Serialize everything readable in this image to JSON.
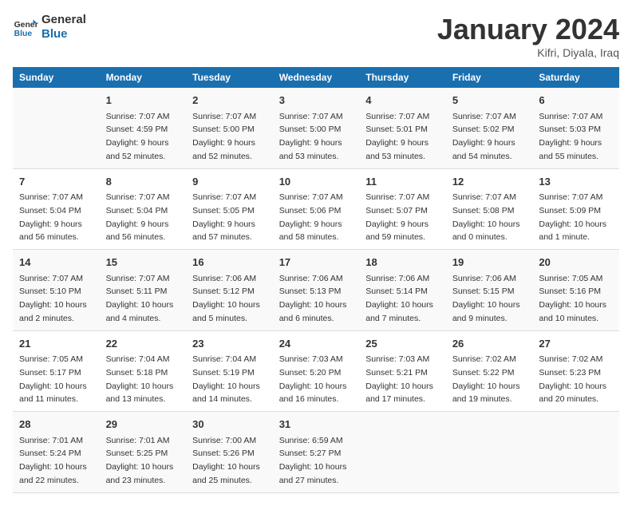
{
  "header": {
    "logo_line1": "General",
    "logo_line2": "Blue",
    "month_title": "January 2024",
    "location": "Kifri, Diyala, Iraq"
  },
  "weekdays": [
    "Sunday",
    "Monday",
    "Tuesday",
    "Wednesday",
    "Thursday",
    "Friday",
    "Saturday"
  ],
  "weeks": [
    [
      {
        "day": "",
        "sunrise": "",
        "sunset": "",
        "daylight": ""
      },
      {
        "day": "1",
        "sunrise": "Sunrise: 7:07 AM",
        "sunset": "Sunset: 4:59 PM",
        "daylight": "Daylight: 9 hours and 52 minutes."
      },
      {
        "day": "2",
        "sunrise": "Sunrise: 7:07 AM",
        "sunset": "Sunset: 5:00 PM",
        "daylight": "Daylight: 9 hours and 52 minutes."
      },
      {
        "day": "3",
        "sunrise": "Sunrise: 7:07 AM",
        "sunset": "Sunset: 5:00 PM",
        "daylight": "Daylight: 9 hours and 53 minutes."
      },
      {
        "day": "4",
        "sunrise": "Sunrise: 7:07 AM",
        "sunset": "Sunset: 5:01 PM",
        "daylight": "Daylight: 9 hours and 53 minutes."
      },
      {
        "day": "5",
        "sunrise": "Sunrise: 7:07 AM",
        "sunset": "Sunset: 5:02 PM",
        "daylight": "Daylight: 9 hours and 54 minutes."
      },
      {
        "day": "6",
        "sunrise": "Sunrise: 7:07 AM",
        "sunset": "Sunset: 5:03 PM",
        "daylight": "Daylight: 9 hours and 55 minutes."
      }
    ],
    [
      {
        "day": "7",
        "sunrise": "Sunrise: 7:07 AM",
        "sunset": "Sunset: 5:04 PM",
        "daylight": "Daylight: 9 hours and 56 minutes."
      },
      {
        "day": "8",
        "sunrise": "Sunrise: 7:07 AM",
        "sunset": "Sunset: 5:04 PM",
        "daylight": "Daylight: 9 hours and 56 minutes."
      },
      {
        "day": "9",
        "sunrise": "Sunrise: 7:07 AM",
        "sunset": "Sunset: 5:05 PM",
        "daylight": "Daylight: 9 hours and 57 minutes."
      },
      {
        "day": "10",
        "sunrise": "Sunrise: 7:07 AM",
        "sunset": "Sunset: 5:06 PM",
        "daylight": "Daylight: 9 hours and 58 minutes."
      },
      {
        "day": "11",
        "sunrise": "Sunrise: 7:07 AM",
        "sunset": "Sunset: 5:07 PM",
        "daylight": "Daylight: 9 hours and 59 minutes."
      },
      {
        "day": "12",
        "sunrise": "Sunrise: 7:07 AM",
        "sunset": "Sunset: 5:08 PM",
        "daylight": "Daylight: 10 hours and 0 minutes."
      },
      {
        "day": "13",
        "sunrise": "Sunrise: 7:07 AM",
        "sunset": "Sunset: 5:09 PM",
        "daylight": "Daylight: 10 hours and 1 minute."
      }
    ],
    [
      {
        "day": "14",
        "sunrise": "Sunrise: 7:07 AM",
        "sunset": "Sunset: 5:10 PM",
        "daylight": "Daylight: 10 hours and 2 minutes."
      },
      {
        "day": "15",
        "sunrise": "Sunrise: 7:07 AM",
        "sunset": "Sunset: 5:11 PM",
        "daylight": "Daylight: 10 hours and 4 minutes."
      },
      {
        "day": "16",
        "sunrise": "Sunrise: 7:06 AM",
        "sunset": "Sunset: 5:12 PM",
        "daylight": "Daylight: 10 hours and 5 minutes."
      },
      {
        "day": "17",
        "sunrise": "Sunrise: 7:06 AM",
        "sunset": "Sunset: 5:13 PM",
        "daylight": "Daylight: 10 hours and 6 minutes."
      },
      {
        "day": "18",
        "sunrise": "Sunrise: 7:06 AM",
        "sunset": "Sunset: 5:14 PM",
        "daylight": "Daylight: 10 hours and 7 minutes."
      },
      {
        "day": "19",
        "sunrise": "Sunrise: 7:06 AM",
        "sunset": "Sunset: 5:15 PM",
        "daylight": "Daylight: 10 hours and 9 minutes."
      },
      {
        "day": "20",
        "sunrise": "Sunrise: 7:05 AM",
        "sunset": "Sunset: 5:16 PM",
        "daylight": "Daylight: 10 hours and 10 minutes."
      }
    ],
    [
      {
        "day": "21",
        "sunrise": "Sunrise: 7:05 AM",
        "sunset": "Sunset: 5:17 PM",
        "daylight": "Daylight: 10 hours and 11 minutes."
      },
      {
        "day": "22",
        "sunrise": "Sunrise: 7:04 AM",
        "sunset": "Sunset: 5:18 PM",
        "daylight": "Daylight: 10 hours and 13 minutes."
      },
      {
        "day": "23",
        "sunrise": "Sunrise: 7:04 AM",
        "sunset": "Sunset: 5:19 PM",
        "daylight": "Daylight: 10 hours and 14 minutes."
      },
      {
        "day": "24",
        "sunrise": "Sunrise: 7:03 AM",
        "sunset": "Sunset: 5:20 PM",
        "daylight": "Daylight: 10 hours and 16 minutes."
      },
      {
        "day": "25",
        "sunrise": "Sunrise: 7:03 AM",
        "sunset": "Sunset: 5:21 PM",
        "daylight": "Daylight: 10 hours and 17 minutes."
      },
      {
        "day": "26",
        "sunrise": "Sunrise: 7:02 AM",
        "sunset": "Sunset: 5:22 PM",
        "daylight": "Daylight: 10 hours and 19 minutes."
      },
      {
        "day": "27",
        "sunrise": "Sunrise: 7:02 AM",
        "sunset": "Sunset: 5:23 PM",
        "daylight": "Daylight: 10 hours and 20 minutes."
      }
    ],
    [
      {
        "day": "28",
        "sunrise": "Sunrise: 7:01 AM",
        "sunset": "Sunset: 5:24 PM",
        "daylight": "Daylight: 10 hours and 22 minutes."
      },
      {
        "day": "29",
        "sunrise": "Sunrise: 7:01 AM",
        "sunset": "Sunset: 5:25 PM",
        "daylight": "Daylight: 10 hours and 23 minutes."
      },
      {
        "day": "30",
        "sunrise": "Sunrise: 7:00 AM",
        "sunset": "Sunset: 5:26 PM",
        "daylight": "Daylight: 10 hours and 25 minutes."
      },
      {
        "day": "31",
        "sunrise": "Sunrise: 6:59 AM",
        "sunset": "Sunset: 5:27 PM",
        "daylight": "Daylight: 10 hours and 27 minutes."
      },
      {
        "day": "",
        "sunrise": "",
        "sunset": "",
        "daylight": ""
      },
      {
        "day": "",
        "sunrise": "",
        "sunset": "",
        "daylight": ""
      },
      {
        "day": "",
        "sunrise": "",
        "sunset": "",
        "daylight": ""
      }
    ]
  ]
}
